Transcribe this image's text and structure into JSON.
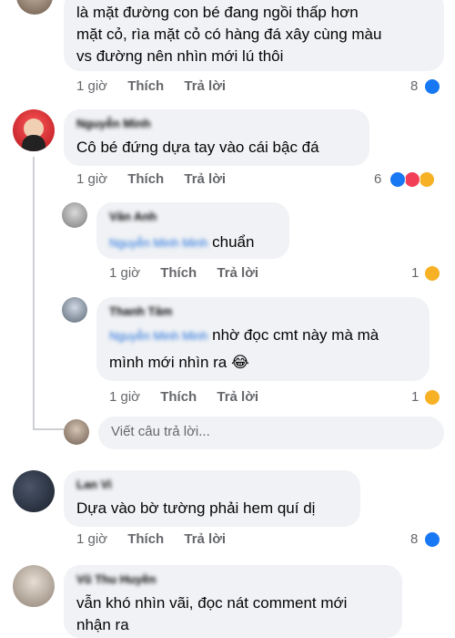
{
  "comments": [
    {
      "text_line1": "là mặt đường con bé đang ngồi thấp hơn",
      "text_line2": "mặt cỏ, rìa mặt cỏ có hàng đá xây cùng màu",
      "text_line3": "vs đường nên nhìn mới lú thôi",
      "time": "1 giờ",
      "like": "Thích",
      "reply": "Trả lời",
      "reactions": "8",
      "reaction_types": [
        "like"
      ]
    },
    {
      "author": "Nguyễn Minh",
      "text": "Cô bé đứng dựa tay vào cái bậc đá",
      "time": "1 giờ",
      "like": "Thích",
      "reply": "Trả lời",
      "reactions": "6",
      "reaction_types": [
        "like",
        "love",
        "haha"
      ],
      "replies": [
        {
          "author": "Vân Anh",
          "mention": "Nguyễn Minh Minh",
          "text": "chuẩn",
          "time": "1 giờ",
          "like": "Thích",
          "reply": "Trả lời",
          "reactions": "1",
          "reaction_types": [
            "haha"
          ]
        },
        {
          "author": "Thanh Tâm",
          "mention": "Nguyễn Minh Minh",
          "text_line1": "nhờ đọc cmt này mà mà",
          "text_line2": "mình mới nhìn ra 😂",
          "time": "1 giờ",
          "like": "Thích",
          "reply": "Trả lời",
          "reactions": "1",
          "reaction_types": [
            "haha"
          ]
        }
      ],
      "reply_placeholder": "Viết câu trả lời..."
    },
    {
      "author": "Lan Vi",
      "text": "Dựa vào bờ tường phải hem quí dị",
      "time": "1 giờ",
      "like": "Thích",
      "reply": "Trả lời",
      "reactions": "8",
      "reaction_types": [
        "like"
      ]
    },
    {
      "author": "Vũ Thu Huyền",
      "text_line1": "vẫn khó nhìn vãi, đọc nát comment mới",
      "text_line2": "nhận ra"
    }
  ],
  "colors": {
    "bubble": "#f0f2f5",
    "meta": "#65676b",
    "mention": "#216fdb",
    "like": "#1877f2",
    "love": "#f33e58",
    "haha": "#f7b125"
  }
}
